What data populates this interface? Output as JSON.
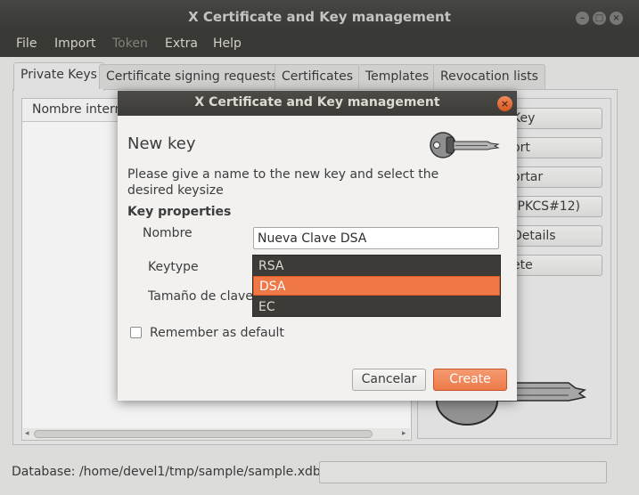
{
  "window": {
    "title": "X Certificate and Key management"
  },
  "menu": [
    "File",
    "Import",
    "Token",
    "Extra",
    "Help"
  ],
  "tabs": [
    "Private Keys",
    "Certificate signing requests",
    "Certificates",
    "Templates",
    "Revocation lists"
  ],
  "list": {
    "column_header": "Nombre intern"
  },
  "right_buttons": [
    "Key",
    "ort",
    "ortar",
    "(PKCS#12)",
    "Details",
    "ete"
  ],
  "status": {
    "text": "Database: /home/devel1/tmp/sample/sample.xdb"
  },
  "dialog": {
    "title": "X Certificate and Key management",
    "heading": "New key",
    "description": "Please give a name to the new key and select the desired keysize",
    "section": "Key properties",
    "name_label": "Nombre",
    "name_value": "Nueva Clave DSA",
    "keytype_label": "Keytype",
    "keysize_label": "Tamaño de clave",
    "keytype_options": [
      "RSA",
      "DSA",
      "EC"
    ],
    "keytype_selected": "DSA",
    "remember_label": "Remember as default",
    "remember_checked": false,
    "cancel_label": "Cancelar",
    "create_label": "Create"
  },
  "colors": {
    "accent": "#f07746",
    "titlebar": "#3c3b37",
    "menubar": "#3c3b37"
  },
  "icons": {
    "dialog_icon": "key-icon",
    "close": "close-icon"
  }
}
